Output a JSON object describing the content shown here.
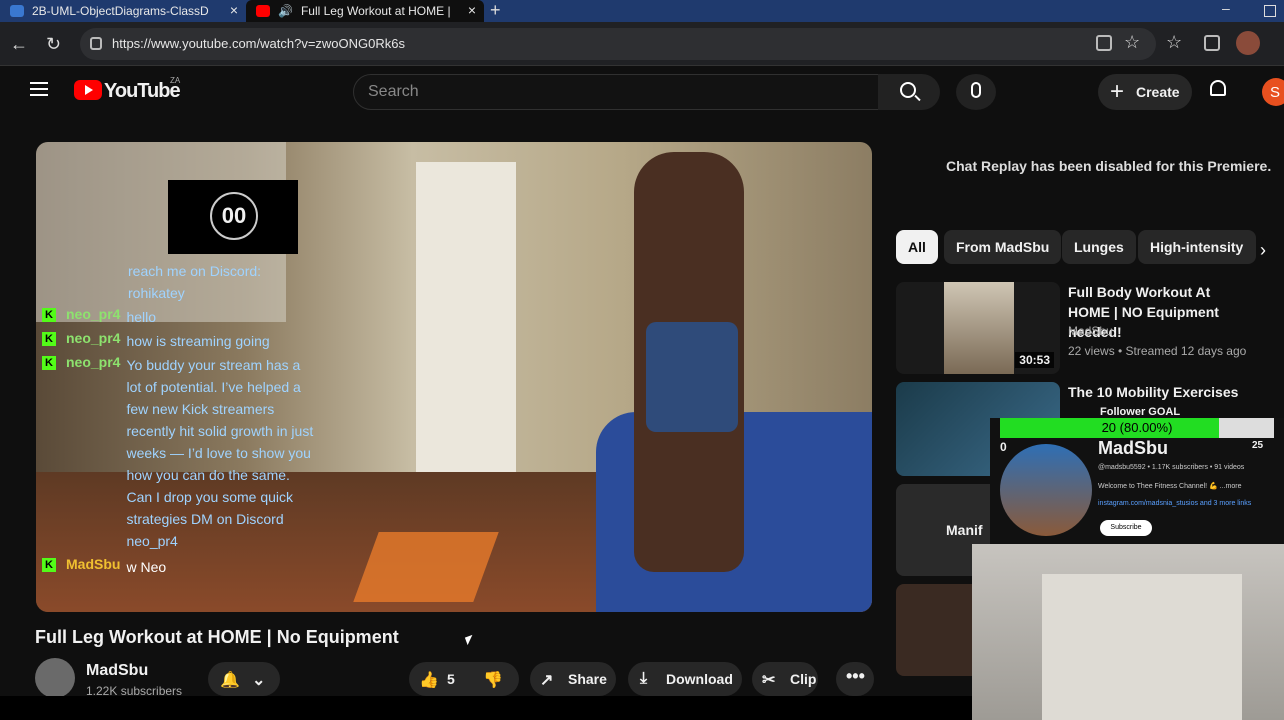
{
  "browser": {
    "tab1": "2B-UML-ObjectDiagrams-ClassD",
    "tab2": "Full Leg Workout at HOME |",
    "close": "×",
    "newtab": "+",
    "minimize": "–",
    "url": "https://www.youtube.com/watch?v=zwoONG0Rk6s"
  },
  "header": {
    "logo_text": "YouTube",
    "country": "ZA",
    "search_placeholder": "Search",
    "create_label": "Create",
    "avatar_letter": "S"
  },
  "player": {
    "timer": "00",
    "chat": [
      {
        "user": "",
        "msg": "reach me on Discord: rohikatey"
      },
      {
        "user": "neo_pr4",
        "msg": "hello"
      },
      {
        "user": "neo_pr4",
        "msg": "how is streaming going"
      },
      {
        "user": "neo_pr4",
        "msg": "Yo buddy your stream has a lot of potential. I’ve helped a few new Kick streamers recently hit solid growth in just weeks — I’d love to show you how you can do the same. Can I drop you some quick strategies DM on Discord neo_pr4"
      },
      {
        "user": "MadSbu",
        "msg": "w Neo"
      }
    ],
    "badge": "K"
  },
  "video": {
    "title": "Full Leg Workout at HOME | No Equipment",
    "channel": "MadSbu",
    "subscribers": "1.22K subscribers",
    "likes": "5",
    "share": "Share",
    "download": "Download",
    "clip": "Clip",
    "more": "•••"
  },
  "sidebar": {
    "chat_replay": "Chat Replay has been disabled for this Premiere.",
    "chips": [
      "All",
      "From MadSbu",
      "Lunges",
      "High-intensity"
    ],
    "videos": [
      {
        "title": "Full Body Workout At HOME | NO Equipment needed!",
        "channel": "MadSbu",
        "meta": "22 views • Streamed 12 days ago",
        "duration": "30:53"
      },
      {
        "title": "The 10 Mobility Exercises I've Done For The Past 10"
      },
      {
        "thumb_text": "Manif"
      }
    ]
  },
  "follower_goal": {
    "label": "Follower GOAL",
    "value_text": "20 (80.00%)",
    "progress": 0.8,
    "min": "0",
    "max": "25",
    "name": "MadSbu",
    "handle": "@madsbu5592 • 1.17K subscribers • 91 videos",
    "desc": "Welcome to Thee Fitness Channel! 💪 ...more",
    "links": "instagram.com/madsnia_stusios and 3 more links",
    "subscribe": "Subscribe"
  }
}
